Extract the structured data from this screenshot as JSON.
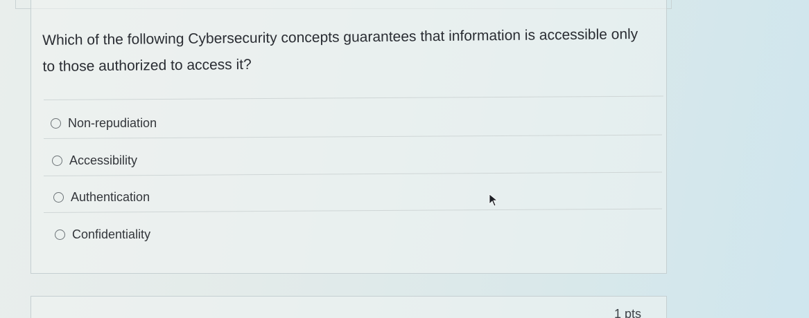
{
  "question": {
    "text": "Which of the following Cybersecurity concepts guarantees that information is accessible only to those authorized to access it?"
  },
  "options": [
    {
      "label": "Non-repudiation",
      "selected": false
    },
    {
      "label": "Accessibility",
      "selected": false
    },
    {
      "label": "Authentication",
      "selected": false
    },
    {
      "label": "Confidentiality",
      "selected": false
    }
  ],
  "next_question": {
    "points_text": "1 pts"
  }
}
